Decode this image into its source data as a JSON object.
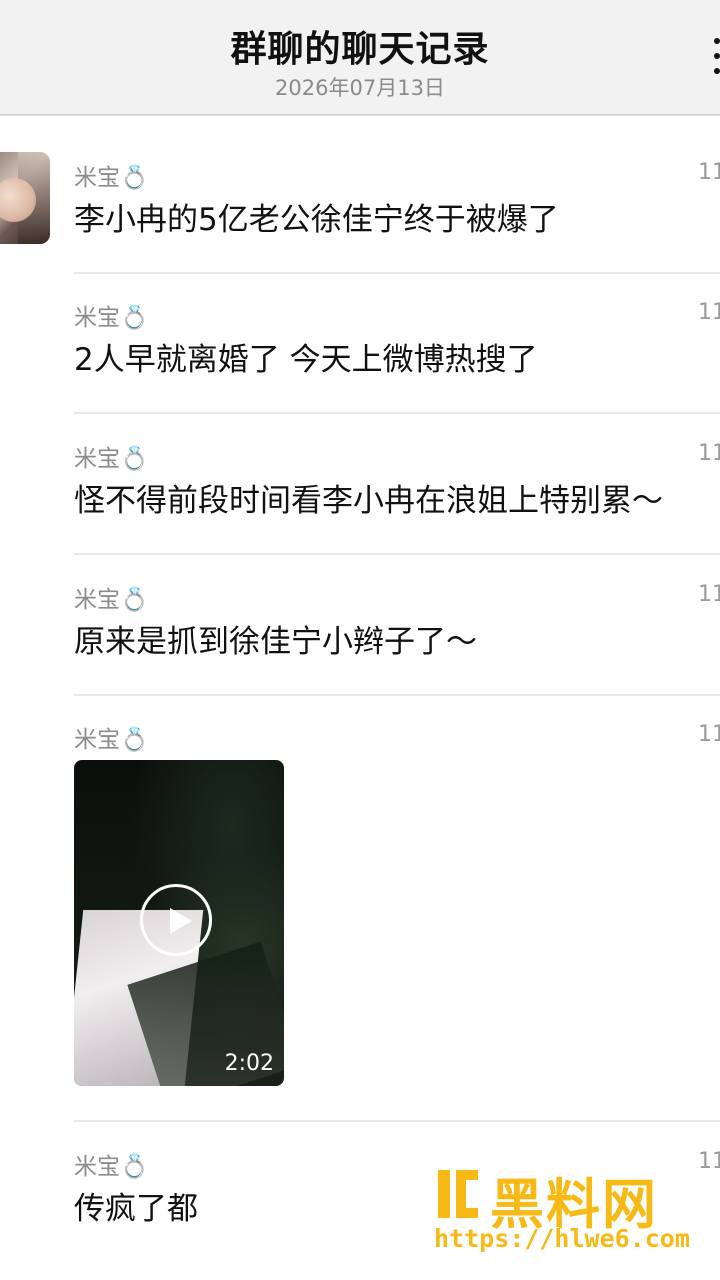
{
  "header": {
    "title": "群聊的聊天记录",
    "date": "2026年07月13日"
  },
  "messages": [
    {
      "sender": "米宝💍",
      "time": "11",
      "text": "李小冉的5亿老公徐佳宁终于被爆了"
    },
    {
      "sender": "米宝💍",
      "time": "11",
      "text": "2人早就离婚了 今天上微博热搜了"
    },
    {
      "sender": "米宝💍",
      "time": "11",
      "text": "怪不得前段时间看李小冉在浪姐上特别累～"
    },
    {
      "sender": "米宝💍",
      "time": "11",
      "text": "原来是抓到徐佳宁小辫子了～"
    },
    {
      "sender": "米宝💍",
      "time": "11",
      "video": {
        "duration": "2:02"
      }
    },
    {
      "sender": "米宝💍",
      "time": "11",
      "text": "传疯了都"
    }
  ],
  "watermark": {
    "brand": "黑料网",
    "url": "https://hlwe6.com"
  },
  "colors": {
    "header_bg": "#f2f2f2",
    "watermark": "#f7b915"
  }
}
